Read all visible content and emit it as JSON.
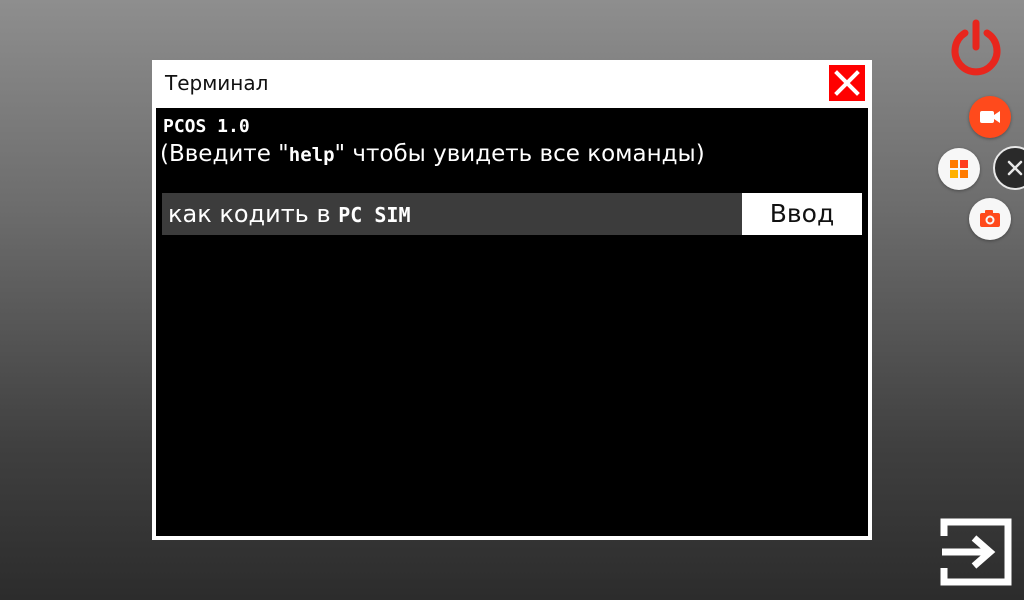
{
  "window": {
    "title": "Терминал"
  },
  "terminal": {
    "header_line": "PCOS 1.0",
    "hint_prefix": "(Введите \"",
    "hint_command": "help",
    "hint_suffix": "\" чтобы увидеть все команды)"
  },
  "input": {
    "value_prefix": "как кодить в ",
    "value_highlight": "PC SIM"
  },
  "enter_button": {
    "label": "Ввод"
  },
  "colors": {
    "close_button": "#ff0000",
    "power_icon": "#e8261d",
    "record_button": "#ff4a1c",
    "terminal_background": "#000000",
    "input_background": "#3c3c3c"
  },
  "icons": {
    "close": "close-icon",
    "power": "power-icon",
    "record": "video-camera-icon",
    "apps": "apps-grid-icon",
    "close_panel": "close-icon",
    "screenshot": "camera-icon",
    "exit": "exit-icon"
  }
}
